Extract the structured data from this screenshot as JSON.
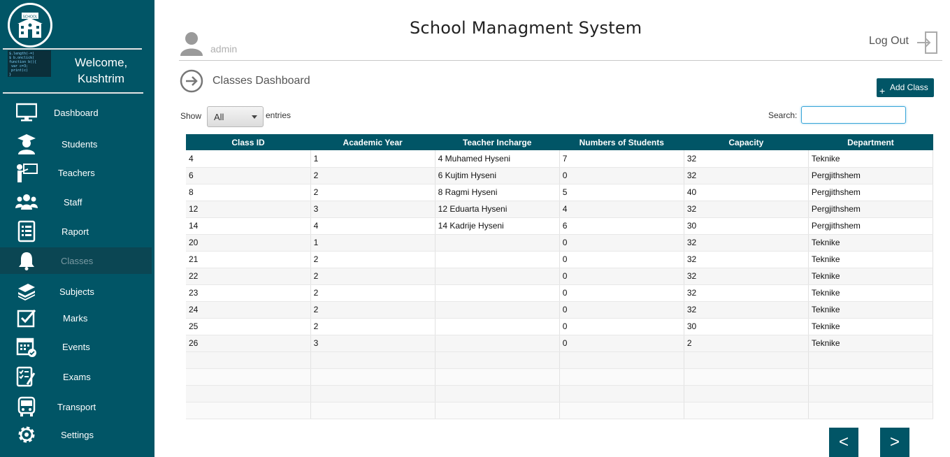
{
  "app": {
    "title": "School Managment System"
  },
  "user": {
    "name": "admin",
    "logout_label": "Log Out"
  },
  "sidebar": {
    "logo_text": "SCHOOL",
    "welcome_line1": "Welcome,",
    "welcome_line2": "Kushtrim",
    "items": [
      {
        "label": "Dashboard",
        "icon": "monitor-icon"
      },
      {
        "label": "Students",
        "icon": "graduate-icon"
      },
      {
        "label": "Teachers",
        "icon": "teacher-board-icon"
      },
      {
        "label": "Staff",
        "icon": "group-icon"
      },
      {
        "label": "Raport",
        "icon": "report-icon"
      },
      {
        "label": "Classes",
        "icon": "bell-icon",
        "active": true
      },
      {
        "label": "Subjects",
        "icon": "books-icon"
      },
      {
        "label": "Marks",
        "icon": "checkbox-icon"
      },
      {
        "label": "Events",
        "icon": "calendar-icon"
      },
      {
        "label": "Exams",
        "icon": "exam-icon"
      },
      {
        "label": "Transport",
        "icon": "bus-icon"
      },
      {
        "label": "Settings",
        "icon": "gear-icon"
      }
    ]
  },
  "page": {
    "title": "Classes Dashboard",
    "add_button": "Add Class",
    "show_label": "Show",
    "entries_value": "All",
    "entries_label": "entries",
    "search_label": "Search:",
    "search_value": ""
  },
  "table": {
    "columns": [
      "Class ID",
      "Academic Year",
      "Teacher Incharge",
      "Numbers of Students",
      "Capacity",
      "Department"
    ],
    "rows": [
      [
        "4",
        "1",
        "4 Muhamed Hyseni",
        "7",
        "32",
        "Teknike"
      ],
      [
        "6",
        "2",
        "6 Kujtim Hyseni",
        "0",
        "32",
        "Pergjithshem"
      ],
      [
        "8",
        "2",
        "8 Ragmi Hyseni",
        "5",
        "40",
        "Pergjithshem"
      ],
      [
        "12",
        "3",
        "12 Eduarta Hyseni",
        "4",
        "32",
        "Pergjithshem"
      ],
      [
        "14",
        "4",
        "14 Kadrije Hyseni",
        "6",
        "30",
        "Pergjithshem"
      ],
      [
        "20",
        "1",
        "",
        "0",
        "32",
        "Teknike"
      ],
      [
        "21",
        "2",
        "",
        "0",
        "32",
        "Teknike"
      ],
      [
        "22",
        "2",
        "",
        "0",
        "32",
        "Teknike"
      ],
      [
        "23",
        "2",
        "",
        "0",
        "32",
        "Teknike"
      ],
      [
        "24",
        "2",
        "",
        "0",
        "32",
        "Teknike"
      ],
      [
        "25",
        "2",
        "",
        "0",
        "30",
        "Teknike"
      ],
      [
        "26",
        "3",
        "",
        "0",
        "2",
        "Teknike"
      ]
    ],
    "empty_rows": 4
  },
  "pagination": {
    "prev_label": "<",
    "next_label": ">"
  }
}
